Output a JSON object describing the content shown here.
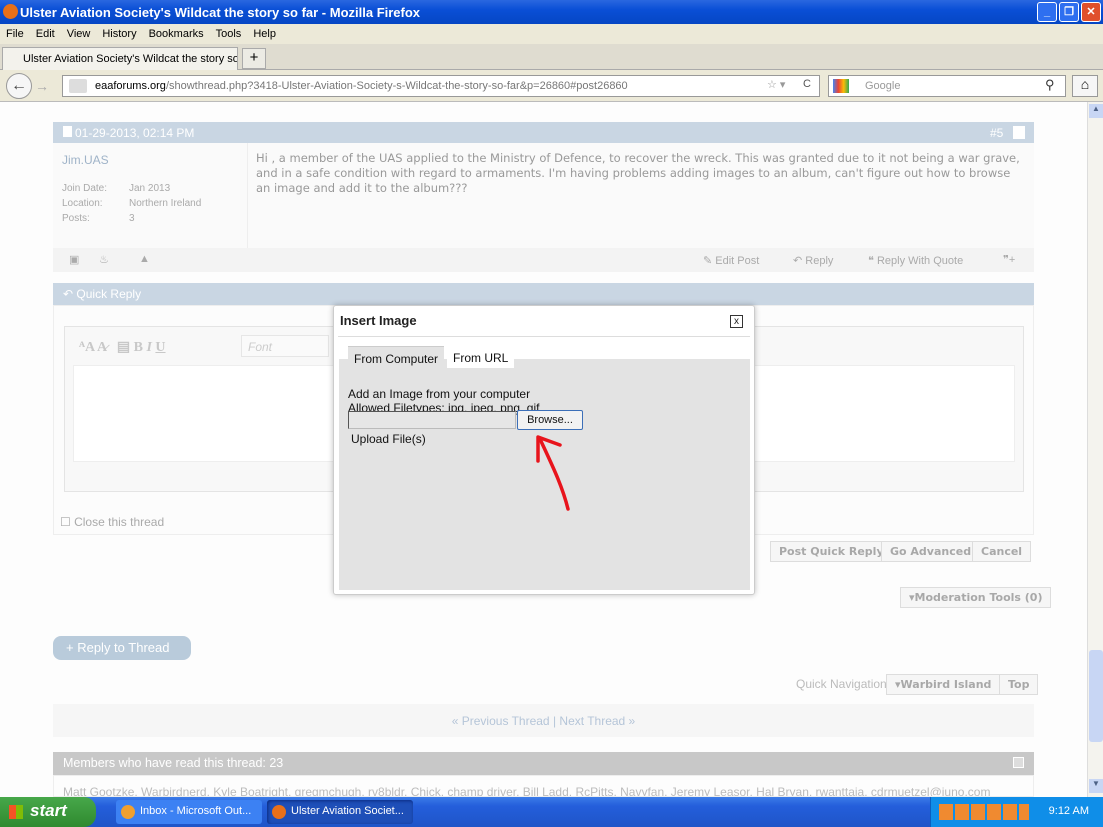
{
  "window": {
    "title": "Ulster Aviation Society's Wildcat the story so far - Mozilla Firefox"
  },
  "menu": [
    "File",
    "Edit",
    "View",
    "History",
    "Bookmarks",
    "Tools",
    "Help"
  ],
  "tab": {
    "label": "Ulster Aviation Society's Wildcat the story so...",
    "new_tab": "+"
  },
  "nav": {
    "url_domain": "eaaforums.org",
    "url_path": "/showthread.php?3418-Ulster-Aviation-Society-s-Wildcat-the-story-so-far&p=26860#post26860",
    "search_placeholder": "Google"
  },
  "post": {
    "date": "01-29-2013, 02:14 PM",
    "number": "#5",
    "author": "Jim.UAS",
    "join_label": "Join Date:",
    "join": "Jan 2013",
    "location_label": "Location:",
    "location": "Northern Ireland",
    "posts_label": "Posts:",
    "posts": "3",
    "body": "Hi , a member of the UAS applied to the Ministry of Defence, to recover the wreck. This was granted due to it not being a war grave, and in a safe condition with regard to armaments. I'm having problems adding images to an album, can't figure out how to browse an image and add it to the album???",
    "actions": {
      "edit": "Edit Post",
      "reply": "Reply",
      "quote": "Reply With Quote"
    }
  },
  "quick_reply": {
    "title": "Quick Reply",
    "font_placeholder": "Font",
    "close_thread": "Close this thread",
    "post": "Post Quick Reply",
    "advanced": "Go Advanced",
    "cancel": "Cancel"
  },
  "moderation": "Moderation Tools (0)",
  "reply_thread": "+ Reply to Thread",
  "quick_nav": {
    "label": "Quick Navigation",
    "forum": "Warbird Island",
    "top": "Top"
  },
  "thread_nav": {
    "prev": "« Previous Thread",
    "sep": "|",
    "next": "Next Thread »"
  },
  "members": {
    "title": "Members who have read this thread: 23",
    "list": "Matt Gootzke, Warbirdnerd, Kyle Boatright, gregmchugh, rv8bldr, Chick, champ driver, Bill Ladd, RcPitts, Navyfan, Jeremy Leasor, Hal Bryan, rwanttaja, cdrmuetzel@juno.com"
  },
  "modal": {
    "title": "Insert Image",
    "close": "x",
    "tabs": [
      "From Computer",
      "From URL"
    ],
    "line1": "Add an Image from your computer",
    "line2": "Allowed Filetypes: jpg, jpeg, png, gif",
    "browse": "Browse...",
    "upload": "Upload File(s)"
  },
  "taskbar": {
    "start": "start",
    "tasks": [
      "Inbox - Microsoft Out...",
      "Ulster Aviation Societ..."
    ],
    "clock": "9:12 AM"
  },
  "colors": {
    "titlebar": "#0a4fd6",
    "annotation_arrow": "#e8141c",
    "header": "#c9d6e3"
  }
}
